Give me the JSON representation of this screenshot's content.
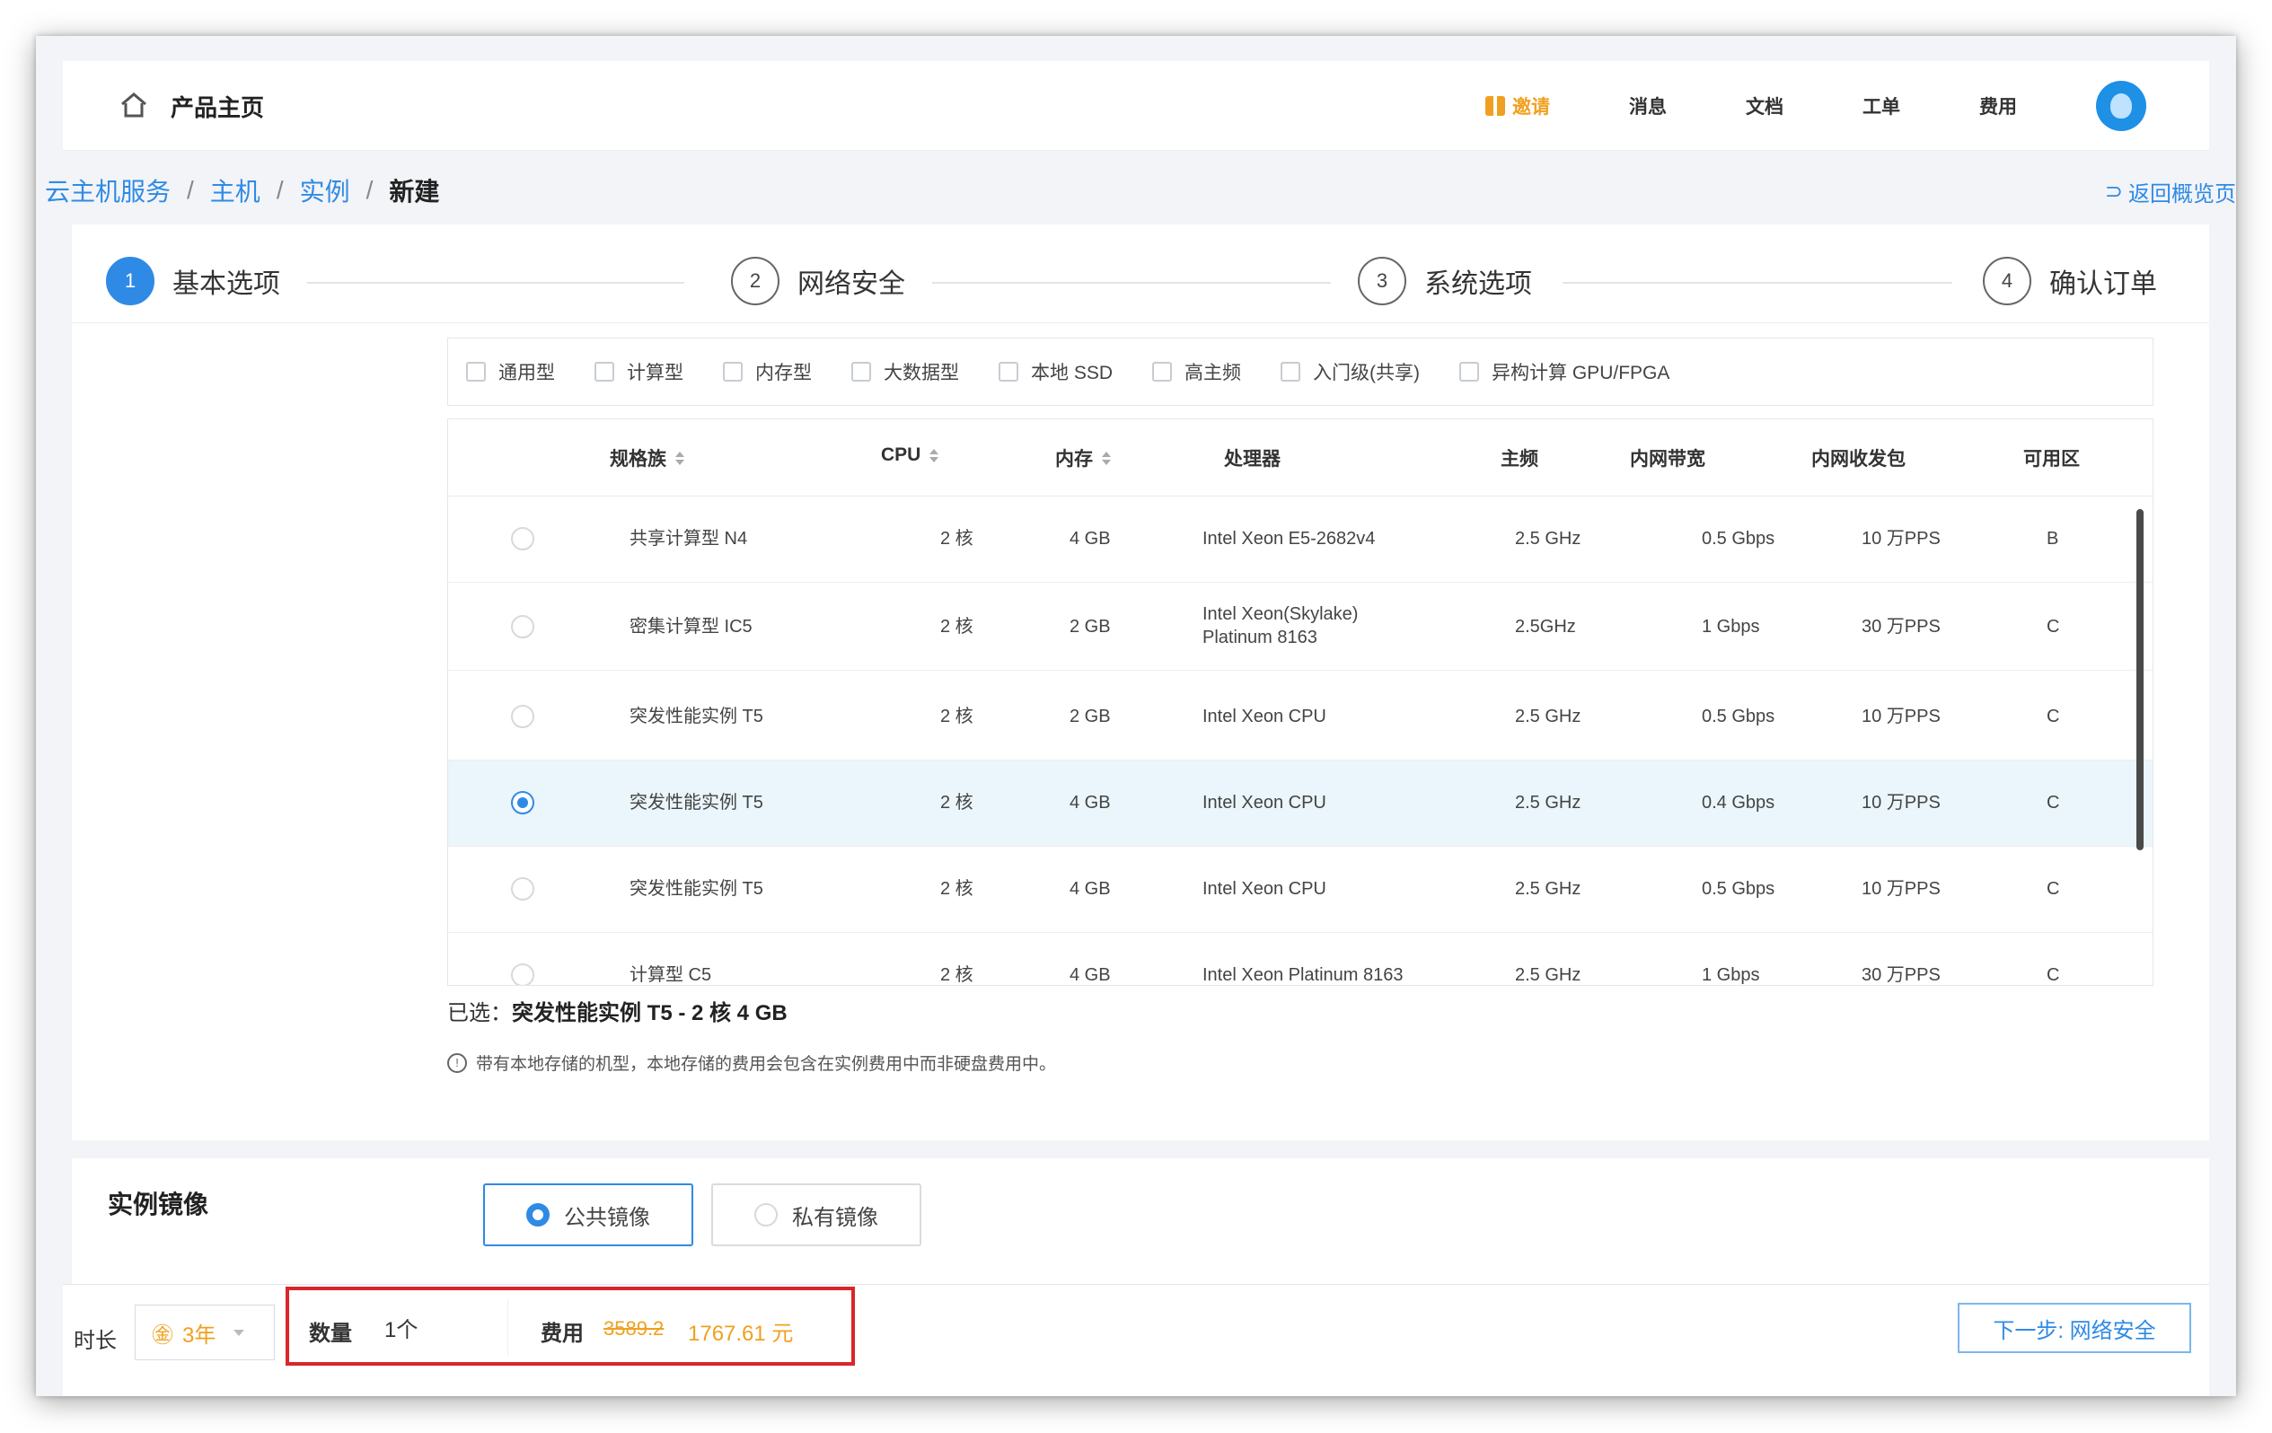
{
  "header": {
    "home_title": "产品主页",
    "nav": [
      "邀请",
      "消息",
      "文档",
      "工单",
      "费用"
    ]
  },
  "breadcrumb": {
    "items": [
      "云主机服务",
      "主机",
      "实例"
    ],
    "current": "新建",
    "back_label": "返回概览页"
  },
  "steps": [
    {
      "num": "1",
      "label": "基本选项"
    },
    {
      "num": "2",
      "label": "网络安全"
    },
    {
      "num": "3",
      "label": "系统选项"
    },
    {
      "num": "4",
      "label": "确认订单"
    }
  ],
  "filters": [
    "通用型",
    "计算型",
    "内存型",
    "大数据型",
    "本地 SSD",
    "高主频",
    "入门级(共享)",
    "异构计算 GPU/FPGA"
  ],
  "table": {
    "headers": {
      "spec": "规格族",
      "cpu": "CPU",
      "mem": "内存",
      "proc": "处理器",
      "freq": "主频",
      "bw": "内网带宽",
      "pps": "内网收发包",
      "zone": "可用区"
    },
    "rows": [
      {
        "spec": "共享计算型 N4",
        "cpu": "2 核",
        "mem": "4 GB",
        "proc": "Intel Xeon E5-2682v4",
        "freq": "2.5 GHz",
        "bw": "0.5 Gbps",
        "pps": "10 万PPS",
        "zone": "B"
      },
      {
        "spec": "密集计算型 IC5",
        "cpu": "2 核",
        "mem": "2 GB",
        "proc": "Intel Xeon(Skylake)",
        "proc2": "Platinum 8163",
        "freq": "2.5GHz",
        "bw": "1 Gbps",
        "pps": "30 万PPS",
        "zone": "C"
      },
      {
        "spec": "突发性能实例 T5",
        "cpu": "2 核",
        "mem": "2 GB",
        "proc": "Intel Xeon CPU",
        "freq": "2.5 GHz",
        "bw": "0.5 Gbps",
        "pps": "10 万PPS",
        "zone": "C"
      },
      {
        "spec": "突发性能实例 T5",
        "cpu": "2 核",
        "mem": "4 GB",
        "proc": "Intel Xeon CPU",
        "freq": "2.5 GHz",
        "bw": "0.4 Gbps",
        "pps": "10 万PPS",
        "zone": "C"
      },
      {
        "spec": "突发性能实例 T5",
        "cpu": "2 核",
        "mem": "4 GB",
        "proc": "Intel Xeon CPU",
        "freq": "2.5 GHz",
        "bw": "0.5 Gbps",
        "pps": "10 万PPS",
        "zone": "C"
      },
      {
        "spec": "计算型 C5",
        "cpu": "2 核",
        "mem": "4 GB",
        "proc": "Intel Xeon Platinum 8163",
        "freq": "2.5 GHz",
        "bw": "1 Gbps",
        "pps": "30 万PPS",
        "zone": "C"
      }
    ]
  },
  "summary": {
    "prefix": "已选：",
    "value": "突发性能实例 T5 - 2 核 4 GB"
  },
  "note": "带有本地存储的机型，本地存储的费用会包含在实例费用中而非硬盘费用中。",
  "image_section": {
    "label": "实例镜像",
    "options": [
      "公共镜像",
      "私有镜像"
    ]
  },
  "bottom": {
    "duration_label": "时长",
    "duration_value": "3年",
    "qty_label": "数量",
    "qty_value": "1个",
    "fee_label": "费用",
    "fee_old": "3589.2",
    "fee_new": "1767.61 元",
    "next_label": "下一步: 网络安全"
  },
  "colors": {
    "accent": "#2f8ae5",
    "price": "#f0a020",
    "highlight_border": "#d9262a",
    "selected_row": "#eaf6fb"
  }
}
